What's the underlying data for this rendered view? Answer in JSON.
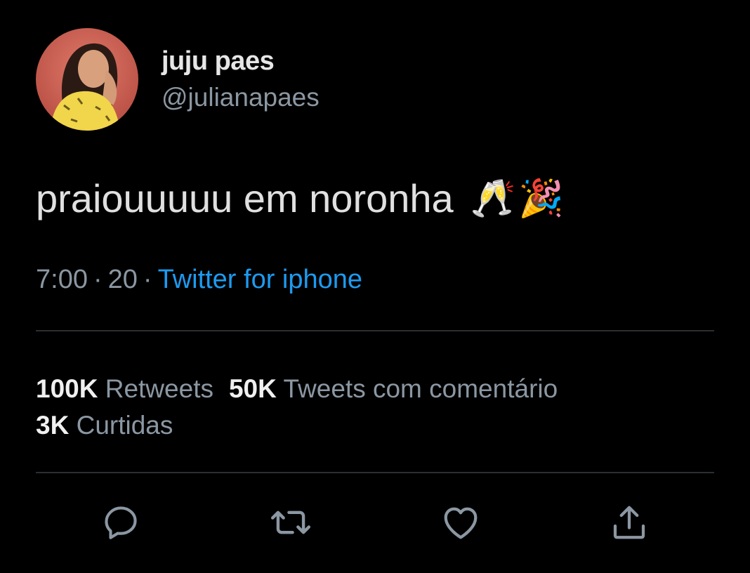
{
  "user": {
    "name": "juju paes",
    "handle": "@julianapaes"
  },
  "tweet": {
    "text": "praiouuuuu em noronha",
    "emojis": [
      "🥂",
      "🎉"
    ]
  },
  "meta": {
    "time": "7:00",
    "separator": "·",
    "date": "20",
    "source": "Twitter for iphone"
  },
  "stats": {
    "retweets": {
      "count": "100K",
      "label": "Retweets"
    },
    "quotes": {
      "count": "50K",
      "label": "Tweets com comentário"
    },
    "likes": {
      "count": "3K",
      "label": "Curtidas"
    }
  },
  "actions": [
    {
      "icon": "reply-icon"
    },
    {
      "icon": "retweet-icon"
    },
    {
      "icon": "like-icon"
    },
    {
      "icon": "share-icon"
    }
  ],
  "colors": {
    "background": "#000000",
    "accent": "#1d9bf0",
    "secondary_text": "#8b97a2",
    "divider": "#2a2f33"
  }
}
